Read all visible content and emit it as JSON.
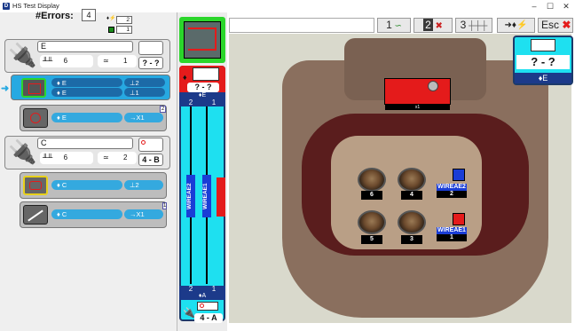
{
  "window": {
    "title": "HS Test Display",
    "app_icon": "D",
    "controls": [
      "–",
      "☐",
      "✕"
    ]
  },
  "errors": {
    "label": "#Errors:",
    "value": "4",
    "mini_counts": [
      "2",
      "1"
    ]
  },
  "connectors": [
    {
      "name": "E",
      "pins": "6",
      "wires": "1",
      "pos": "? - ?"
    },
    {
      "name": "C",
      "pins": "6",
      "wires": "2",
      "pos": "4 - B"
    }
  ],
  "errors_list": [
    {
      "rows": [
        {
          "label": "E",
          "value": "⊥2"
        },
        {
          "label": "E",
          "value": "⊥1"
        }
      ]
    },
    {
      "rows": [
        {
          "label": "E",
          "value": "→X1"
        }
      ],
      "badge": "2"
    },
    {
      "rows": [
        {
          "label": "C",
          "value": "⊥2"
        }
      ]
    },
    {
      "rows": [
        {
          "label": "C",
          "value": "→X1"
        }
      ],
      "badge": "1"
    }
  ],
  "mid": {
    "top_pos": "? - ?",
    "top_conn": "E",
    "top_pins": [
      "2",
      "1"
    ],
    "wires": [
      "WIREAE2",
      "WIREAE1"
    ],
    "bottom_pins": [
      "2",
      "1"
    ],
    "bottom_conn": "A",
    "bottom_pos": "4 - A"
  },
  "toolbar": {
    "btn1": "1",
    "btn2": "2",
    "btn3": "3",
    "esc": "Esc"
  },
  "preview": {
    "pos": "? - ?",
    "conn": "E"
  },
  "photo": {
    "cavities": [
      "6",
      "4",
      "5",
      "3"
    ],
    "wire_labels": [
      {
        "name": "WIREAE2",
        "pin": "2"
      },
      {
        "name": "WIREAE1",
        "pin": "1"
      }
    ],
    "latch_label": "x1"
  },
  "colors": {
    "accent": "#34a9df",
    "dark": "#1c6aa7",
    "mid_bg": "#1ee0f0",
    "red": "#e41b1b",
    "green": "#2bd62b"
  }
}
